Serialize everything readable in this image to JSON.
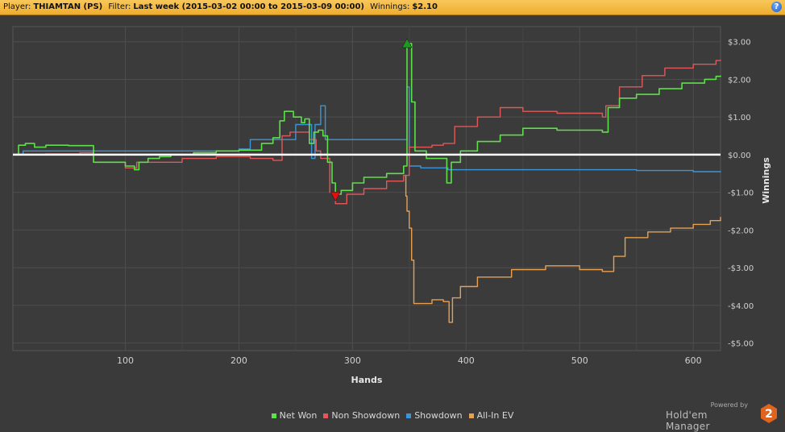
{
  "header": {
    "player_label": "Player:",
    "player_value": "THIAMTAN (PS)",
    "filter_label": "Filter:",
    "filter_value": "Last week (2015-03-02 00:00 to 2015-03-09 00:00)",
    "winnings_label": "Winnings:",
    "winnings_value": "$2.10",
    "help_glyph": "?"
  },
  "brand": {
    "powered_by": "Powered by",
    "name": "Hold'em Manager",
    "logo_digit": "2"
  },
  "chart_data": {
    "type": "line",
    "xlabel": "Hands",
    "ylabel": "Winnings",
    "xlim": [
      1,
      624
    ],
    "ylim": [
      -5.2,
      3.4
    ],
    "x_ticks": [
      100,
      200,
      300,
      400,
      500,
      600
    ],
    "x_tick_labels": [
      "100",
      "200",
      "300",
      "400",
      "500",
      "600"
    ],
    "y_ticks": [
      3,
      2,
      1,
      0,
      -1,
      -2,
      -3,
      -4,
      -5
    ],
    "y_tick_labels": [
      "$3.00",
      "$2.00",
      "$1.00",
      "$0.00",
      "-$1.00",
      "-$2.00",
      "-$3.00",
      "-$4.00",
      "-$5.00"
    ],
    "grid": true,
    "legend_position": "bottom",
    "zero_line_color": "#ffffff",
    "markers": [
      {
        "type": "max",
        "series": "Net Won",
        "x": 348,
        "y": 2.95,
        "color": "#1f9a1f"
      },
      {
        "type": "min",
        "series": "Net Won",
        "x": 285,
        "y": -1.1,
        "color": "#e01010"
      }
    ],
    "series": [
      {
        "name": "Net Won",
        "color": "#5ee04a",
        "points": [
          [
            1,
            0
          ],
          [
            6,
            0.25
          ],
          [
            12,
            0.3
          ],
          [
            20,
            0.2
          ],
          [
            30,
            0.25
          ],
          [
            50,
            0.24
          ],
          [
            70,
            0.24
          ],
          [
            72,
            -0.2
          ],
          [
            100,
            -0.3
          ],
          [
            108,
            -0.4
          ],
          [
            112,
            -0.2
          ],
          [
            120,
            -0.1
          ],
          [
            130,
            -0.05
          ],
          [
            140,
            0
          ],
          [
            160,
            0.05
          ],
          [
            180,
            0.1
          ],
          [
            200,
            0.12
          ],
          [
            220,
            0.3
          ],
          [
            230,
            0.45
          ],
          [
            236,
            0.9
          ],
          [
            240,
            1.15
          ],
          [
            248,
            1.0
          ],
          [
            255,
            0.85
          ],
          [
            258,
            0.95
          ],
          [
            262,
            0.3
          ],
          [
            266,
            0.6
          ],
          [
            270,
            0.65
          ],
          [
            274,
            0.5
          ],
          [
            278,
            -0.2
          ],
          [
            282,
            -0.75
          ],
          [
            285,
            -1.05
          ],
          [
            290,
            -0.95
          ],
          [
            300,
            -0.75
          ],
          [
            310,
            -0.6
          ],
          [
            330,
            -0.5
          ],
          [
            345,
            -0.3
          ],
          [
            348,
            2.95
          ],
          [
            352,
            1.4
          ],
          [
            355,
            0.1
          ],
          [
            365,
            -0.1
          ],
          [
            380,
            -0.1
          ],
          [
            383,
            -0.75
          ],
          [
            387,
            -0.2
          ],
          [
            395,
            0.1
          ],
          [
            410,
            0.35
          ],
          [
            430,
            0.52
          ],
          [
            450,
            0.7
          ],
          [
            480,
            0.65
          ],
          [
            500,
            0.65
          ],
          [
            520,
            0.6
          ],
          [
            525,
            1.25
          ],
          [
            535,
            1.5
          ],
          [
            550,
            1.6
          ],
          [
            570,
            1.75
          ],
          [
            590,
            1.9
          ],
          [
            600,
            1.9
          ],
          [
            610,
            2.0
          ],
          [
            620,
            2.08
          ],
          [
            624,
            2.1
          ]
        ]
      },
      {
        "name": "Non Showdown",
        "color": "#e05858",
        "points": [
          [
            1,
            0
          ],
          [
            30,
            0.02
          ],
          [
            60,
            0.05
          ],
          [
            72,
            -0.2
          ],
          [
            100,
            -0.35
          ],
          [
            110,
            -0.2
          ],
          [
            150,
            -0.1
          ],
          [
            180,
            -0.05
          ],
          [
            210,
            -0.1
          ],
          [
            230,
            -0.15
          ],
          [
            238,
            0.5
          ],
          [
            245,
            0.6
          ],
          [
            262,
            0.4
          ],
          [
            268,
            0.1
          ],
          [
            272,
            -0.1
          ],
          [
            280,
            -1.0
          ],
          [
            285,
            -1.3
          ],
          [
            295,
            -1.05
          ],
          [
            310,
            -0.9
          ],
          [
            330,
            -0.7
          ],
          [
            345,
            -0.55
          ],
          [
            350,
            0.2
          ],
          [
            370,
            0.25
          ],
          [
            380,
            0.3
          ],
          [
            390,
            0.75
          ],
          [
            410,
            1.0
          ],
          [
            430,
            1.25
          ],
          [
            450,
            1.15
          ],
          [
            480,
            1.1
          ],
          [
            500,
            1.1
          ],
          [
            520,
            1.0
          ],
          [
            523,
            1.3
          ],
          [
            535,
            1.8
          ],
          [
            555,
            2.1
          ],
          [
            575,
            2.3
          ],
          [
            600,
            2.4
          ],
          [
            620,
            2.5
          ],
          [
            624,
            2.52
          ]
        ]
      },
      {
        "name": "Showdown",
        "color": "#3e95d6",
        "points": [
          [
            1,
            0
          ],
          [
            10,
            0.1
          ],
          [
            70,
            0.1
          ],
          [
            100,
            0.1
          ],
          [
            200,
            0.15
          ],
          [
            210,
            0.4
          ],
          [
            240,
            0.4
          ],
          [
            250,
            0.8
          ],
          [
            262,
            0.8
          ],
          [
            264,
            -0.1
          ],
          [
            267,
            0.8
          ],
          [
            272,
            1.3
          ],
          [
            276,
            0.4
          ],
          [
            300,
            0.4
          ],
          [
            345,
            0.4
          ],
          [
            348,
            1.8
          ],
          [
            350,
            -0.3
          ],
          [
            360,
            -0.35
          ],
          [
            380,
            -0.35
          ],
          [
            384,
            -0.4
          ],
          [
            450,
            -0.4
          ],
          [
            500,
            -0.4
          ],
          [
            550,
            -0.42
          ],
          [
            600,
            -0.45
          ],
          [
            624,
            -0.47
          ]
        ]
      },
      {
        "name": "All-In EV",
        "color": "#e8a050",
        "points": [
          [
            346,
            -0.55
          ],
          [
            347,
            -1.1
          ],
          [
            348,
            -1.5
          ],
          [
            350,
            -1.95
          ],
          [
            352,
            -2.8
          ],
          [
            354,
            -3.95
          ],
          [
            370,
            -3.85
          ],
          [
            380,
            -3.9
          ],
          [
            385,
            -4.45
          ],
          [
            388,
            -3.8
          ],
          [
            395,
            -3.5
          ],
          [
            410,
            -3.25
          ],
          [
            440,
            -3.05
          ],
          [
            470,
            -2.95
          ],
          [
            500,
            -3.05
          ],
          [
            520,
            -3.1
          ],
          [
            530,
            -2.7
          ],
          [
            540,
            -2.2
          ],
          [
            560,
            -2.05
          ],
          [
            580,
            -1.95
          ],
          [
            600,
            -1.85
          ],
          [
            615,
            -1.75
          ],
          [
            624,
            -1.65
          ]
        ]
      }
    ]
  }
}
